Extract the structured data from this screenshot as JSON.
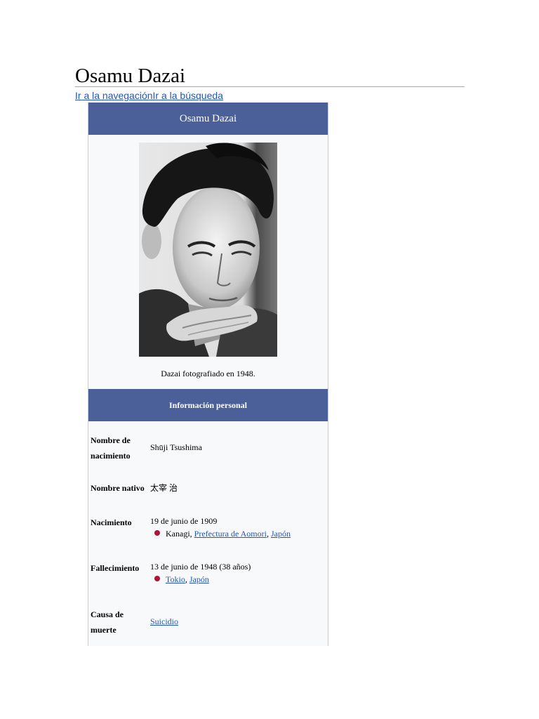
{
  "page": {
    "title": "Osamu Dazai",
    "nav": {
      "to_navigation": "Ir a la navegación",
      "to_search": "Ir a la búsqueda"
    }
  },
  "infobox": {
    "header": "Osamu Dazai",
    "photo_alt": "Osamu Dazai",
    "caption": "Dazai fotografiado en 1948.",
    "section_title": "Información personal",
    "rows": {
      "birth_name": {
        "label": "Nombre de nacimiento",
        "value": "Shūji Tsushima"
      },
      "native_name": {
        "label": "Nombre nativo",
        "value": "太宰 治"
      },
      "birth": {
        "label": "Nacimiento",
        "date": "19 de junio de 1909",
        "place_plain": "Kanagi, ",
        "place_link_1": "Prefectura de Aomori",
        "separator": ", ",
        "place_link_2": "Japón",
        "marker_color": "#b0123a"
      },
      "death": {
        "label": "Fallecimiento",
        "date": "13 de junio de 1948 (38 años)",
        "place_link_1": "Tokio",
        "separator": ", ",
        "place_link_2": "Japón",
        "marker_color": "#b0123a"
      },
      "cause_of_death": {
        "label": "Causa de muerte",
        "value": "Suicidio"
      }
    }
  },
  "colors": {
    "infobox_header": "#4b5f99",
    "link": "#2255bb",
    "infobox_background": "#f8f9fa"
  }
}
